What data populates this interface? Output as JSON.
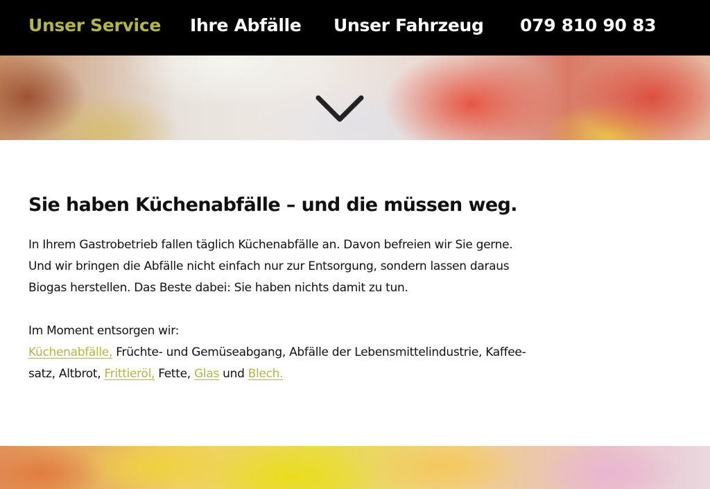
{
  "nav": {
    "service": "Unser Service",
    "abfaelle": "Ihre Abfälle",
    "fahrzeug": "Unser Fahrzeug",
    "phone": "079 810 90 83"
  },
  "hero": {
    "scroll_icon": "chevron-down-icon"
  },
  "content": {
    "headline": "Sie haben Küchenabfälle – und die müssen weg.",
    "intro_lines": [
      "In Ihrem Gastrobetrieb fallen täglich Küchenabfälle an. Davon befreien wir Sie gerne.",
      "Und wir bringen die Abfälle nicht einfach nur zur Entsorgung, sondern lassen daraus",
      "Biogas herstellen. Das Beste dabei: Sie haben nichts damit zu tun."
    ],
    "waste_intro": "Im Moment entsorgen wir:",
    "link_kuechenabfaelle": "Küchenabfälle,",
    "text_fruechte": " Früchte- und Gemüseabgang, Abfälle der Lebensmittelindustrie, Kaffee-",
    "text_satz": "satz, Altbrot, ",
    "link_frittieroel": "Frittieröl,",
    "text_fette": " Fette, ",
    "link_glas": "Glas",
    "text_und": " und ",
    "link_blech": "Blech."
  },
  "colors": {
    "accent": "#b3b740",
    "nav_bg": "#000000",
    "text": "#111111"
  }
}
